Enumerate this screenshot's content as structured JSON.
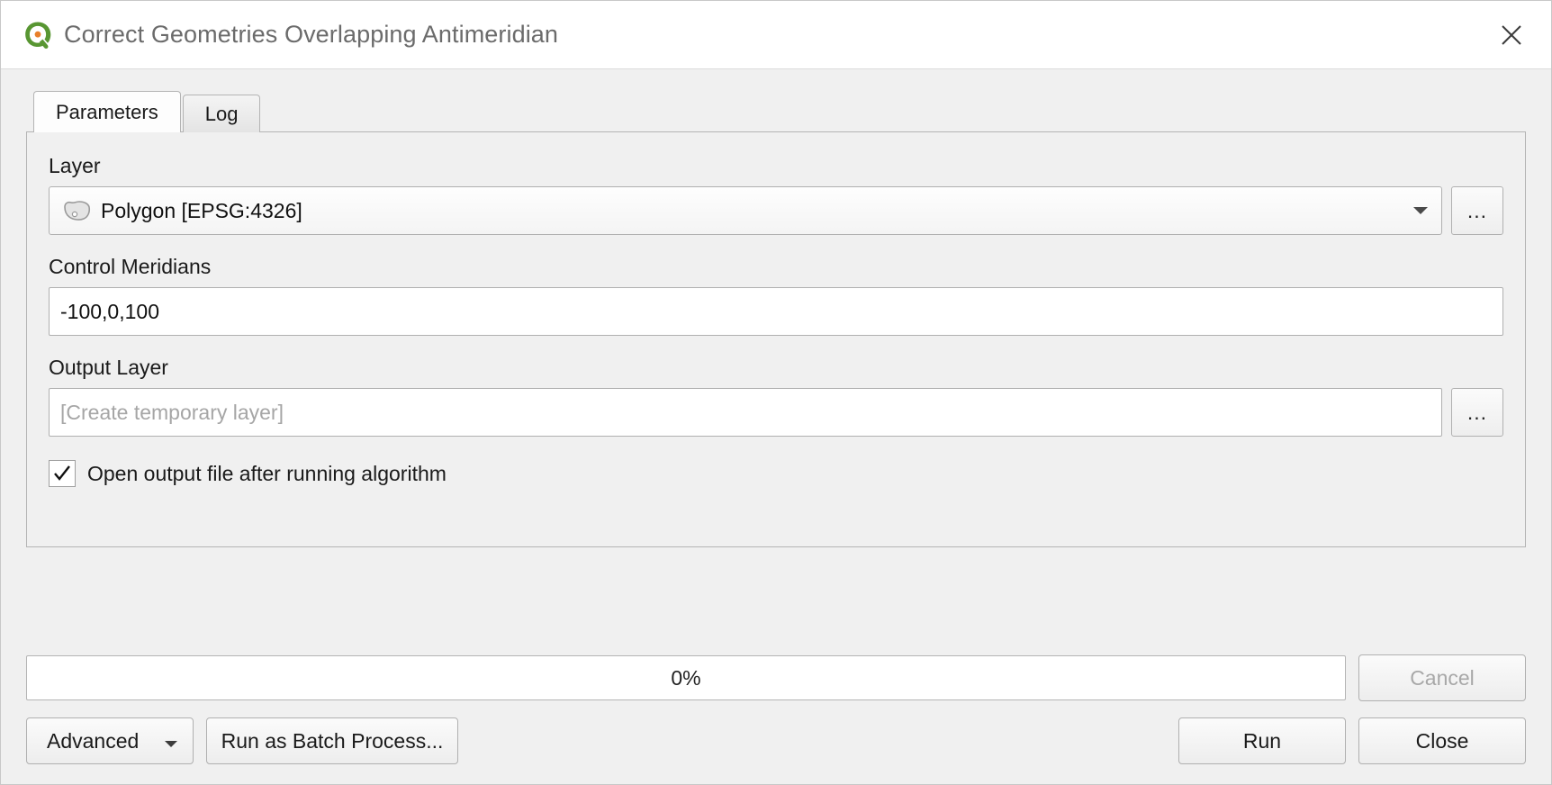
{
  "window": {
    "title": "Correct Geometries Overlapping Antimeridian",
    "app_icon": "qgis-logo-icon",
    "close_icon": "close-icon"
  },
  "tabs": [
    {
      "label": "Parameters",
      "active": true
    },
    {
      "label": "Log",
      "active": false
    }
  ],
  "parameters": {
    "layer": {
      "label": "Layer",
      "value": "Polygon [EPSG:4326]",
      "layer_icon": "polygon-layer-icon",
      "dropdown_icon": "chevron-down-icon",
      "browse_label": "..."
    },
    "control_meridians": {
      "label": "Control Meridians",
      "value": "-100,0,100"
    },
    "output_layer": {
      "label": "Output Layer",
      "value": "",
      "placeholder": "[Create temporary layer]",
      "browse_label": "..."
    },
    "open_output": {
      "label": "Open output file after running algorithm",
      "checked": true,
      "check_icon": "checkmark-icon"
    }
  },
  "footer": {
    "progress_text": "0%",
    "progress_percent": 0,
    "cancel_label": "Cancel",
    "advanced_label": "Advanced",
    "advanced_arrow_icon": "chevron-down-icon",
    "batch_label": "Run as Batch Process...",
    "run_label": "Run",
    "close_label": "Close"
  },
  "colors": {
    "window_bg": "#f0f0f0",
    "titlebar_bg": "#ffffff",
    "title_text": "#6b6b6b",
    "border": "#b4b4b4",
    "input_bg": "#ffffff",
    "placeholder_text": "#a6a6a6",
    "disabled_text": "#a8a8a8",
    "qgis_green": "#589632",
    "qgis_orange": "#e8802a"
  }
}
